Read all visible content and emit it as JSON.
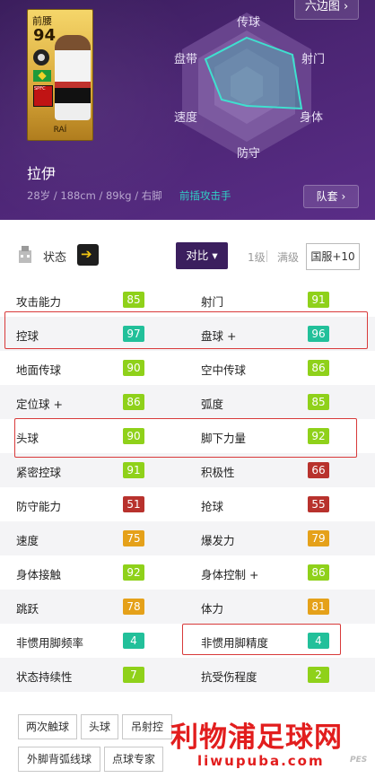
{
  "header": {
    "card": {
      "position": "前腰",
      "overall": "94",
      "name": "RAÍ",
      "club_abbr": "SPFD"
    },
    "hex_button": "六边图",
    "radar_labels": {
      "top": "传球",
      "top_right": "射门",
      "bottom_right": "身体",
      "bottom": "防守",
      "bottom_left": "速度",
      "top_left": "盘带"
    },
    "player_name": "拉伊",
    "player_info": "28岁 / 188cm / 89kg / 右脚",
    "playing_style": "前插攻击手",
    "team_button": "队套"
  },
  "toolbar": {
    "status_label": "状态",
    "compare_label": "对比",
    "level_1": "1级",
    "level_max": "满级",
    "server_label": "国服+10"
  },
  "stats": [
    {
      "left": {
        "name": "攻击能力",
        "value": "85",
        "color": "#8fd11a"
      },
      "right": {
        "name": "射门",
        "value": "91",
        "color": "#8fd11a"
      }
    },
    {
      "left": {
        "name": "控球",
        "value": "97",
        "color": "#22c09a"
      },
      "right": {
        "name": "盘球 +",
        "value": "96",
        "color": "#22c09a"
      }
    },
    {
      "left": {
        "name": "地面传球",
        "value": "90",
        "color": "#8fd11a"
      },
      "right": {
        "name": "空中传球",
        "value": "86",
        "color": "#8fd11a"
      }
    },
    {
      "left": {
        "name": "定位球 +",
        "value": "86",
        "color": "#8fd11a"
      },
      "right": {
        "name": "弧度",
        "value": "85",
        "color": "#8fd11a"
      }
    },
    {
      "left": {
        "name": "头球",
        "value": "90",
        "color": "#8fd11a"
      },
      "right": {
        "name": "脚下力量",
        "value": "92",
        "color": "#8fd11a"
      }
    },
    {
      "left": {
        "name": "紧密控球",
        "value": "91",
        "color": "#8fd11a"
      },
      "right": {
        "name": "积极性",
        "value": "66",
        "color": "#b8322d"
      }
    },
    {
      "left": {
        "name": "防守能力",
        "value": "51",
        "color": "#b8322d"
      },
      "right": {
        "name": "抢球",
        "value": "55",
        "color": "#b8322d"
      }
    },
    {
      "left": {
        "name": "速度",
        "value": "75",
        "color": "#e5a11a"
      },
      "right": {
        "name": "爆发力",
        "value": "79",
        "color": "#e5a11a"
      }
    },
    {
      "left": {
        "name": "身体接触",
        "value": "92",
        "color": "#8fd11a"
      },
      "right": {
        "name": "身体控制 +",
        "value": "86",
        "color": "#8fd11a"
      }
    },
    {
      "left": {
        "name": "跳跃",
        "value": "78",
        "color": "#e5a11a"
      },
      "right": {
        "name": "体力",
        "value": "81",
        "color": "#e5a11a"
      }
    },
    {
      "left": {
        "name": "非惯用脚频率",
        "value": "4",
        "color": "#22c09a"
      },
      "right": {
        "name": "非惯用脚精度",
        "value": "4",
        "color": "#22c09a"
      }
    },
    {
      "left": {
        "name": "状态持续性",
        "value": "7",
        "color": "#8fd11a"
      },
      "right": {
        "name": "抗受伤程度",
        "value": "2",
        "color": "#8fd11a"
      }
    }
  ],
  "skills": [
    "两次触球",
    "头球",
    "吊射控",
    "外脚背弧线球",
    "点球专家"
  ],
  "watermark": {
    "line1": "利物浦足球网",
    "line2": "liwupuba.com"
  },
  "brand": "PES"
}
